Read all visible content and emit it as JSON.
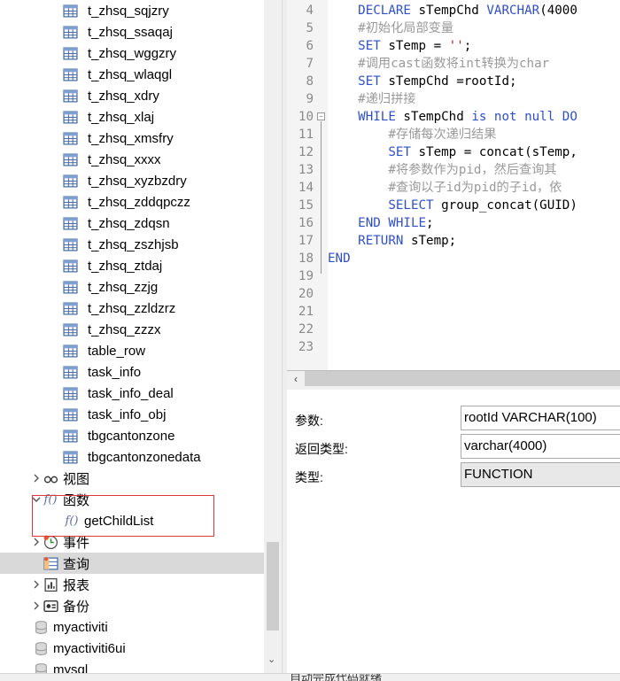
{
  "tree": {
    "tables": [
      "t_zhsq_sqjzry",
      "t_zhsq_ssaqaj",
      "t_zhsq_wggzry",
      "t_zhsq_wlaqgl",
      "t_zhsq_xdry",
      "t_zhsq_xlaj",
      "t_zhsq_xmsfry",
      "t_zhsq_xxxx",
      "t_zhsq_xyzbzdry",
      "t_zhsq_zddqpczz",
      "t_zhsq_zdqsn",
      "t_zhsq_zszhjsb",
      "t_zhsq_ztdaj",
      "t_zhsq_zzjg",
      "t_zhsq_zzldzrz",
      "t_zhsq_zzzx",
      "table_row",
      "task_info",
      "task_info_deal",
      "task_info_obj",
      "tbgcantonzone",
      "tbgcantonzonedata"
    ],
    "views_label": "视图",
    "functions_label": "函数",
    "function_item": "getChildList",
    "events_label": "事件",
    "queries_label": "查询",
    "reports_label": "报表",
    "backups_label": "备份",
    "databases": [
      "myactiviti",
      "myactiviti6ui",
      "mysql"
    ]
  },
  "editor": {
    "lines": [
      {
        "n": "4",
        "parts": [
          [
            "    ",
            ""
          ],
          [
            "DECLARE",
            "kw"
          ],
          [
            " sTempChd ",
            ""
          ],
          [
            "VARCHAR",
            "kw"
          ],
          [
            "(4000",
            ""
          ]
        ]
      },
      {
        "n": "5",
        "parts": [
          [
            "    ",
            ""
          ],
          [
            "#初始化局部变量",
            "cm"
          ]
        ]
      },
      {
        "n": "6",
        "parts": [
          [
            "    ",
            ""
          ],
          [
            "SET",
            "kw"
          ],
          [
            " sTemp = ",
            ""
          ],
          [
            "''",
            "str"
          ],
          [
            ";",
            ""
          ]
        ]
      },
      {
        "n": "7",
        "parts": [
          [
            "    ",
            ""
          ],
          [
            "#调用cast函数将int转换为char",
            "cm"
          ]
        ]
      },
      {
        "n": "8",
        "parts": [
          [
            "    ",
            ""
          ],
          [
            "SET",
            "kw"
          ],
          [
            " sTempChd =rootId;",
            ""
          ]
        ]
      },
      {
        "n": "9",
        "parts": [
          [
            "    ",
            ""
          ],
          [
            "#递归拼接",
            "cm"
          ]
        ]
      },
      {
        "n": "10",
        "parts": [
          [
            "    ",
            ""
          ],
          [
            "WHILE",
            "kw"
          ],
          [
            " sTempChd ",
            ""
          ],
          [
            "is not null DO",
            "kw"
          ]
        ]
      },
      {
        "n": "11",
        "parts": [
          [
            "        ",
            ""
          ],
          [
            "#存储每次递归结果",
            "cm"
          ]
        ]
      },
      {
        "n": "12",
        "parts": [
          [
            "        ",
            ""
          ],
          [
            "SET",
            "kw"
          ],
          [
            " sTemp = concat(sTemp,",
            ""
          ]
        ]
      },
      {
        "n": "13",
        "parts": [
          [
            "        ",
            ""
          ],
          [
            "#将参数作为pid，然后查询其",
            "cm"
          ]
        ]
      },
      {
        "n": "14",
        "parts": [
          [
            "        ",
            ""
          ],
          [
            "#查询以子id为pid的子id，依",
            "cm"
          ]
        ]
      },
      {
        "n": "15",
        "parts": [
          [
            "        ",
            ""
          ],
          [
            "SELECT",
            "kw"
          ],
          [
            " group_concat(GUID)",
            ""
          ]
        ]
      },
      {
        "n": "16",
        "parts": [
          [
            "    ",
            ""
          ],
          [
            "END WHILE",
            "kw"
          ],
          [
            ";",
            ""
          ]
        ]
      },
      {
        "n": "17",
        "parts": [
          [
            "    ",
            ""
          ],
          [
            "RETURN",
            "kw"
          ],
          [
            " sTemp;",
            ""
          ]
        ]
      },
      {
        "n": "18",
        "parts": [
          [
            "",
            ""
          ],
          [
            "END",
            "kw"
          ]
        ]
      },
      {
        "n": "19",
        "parts": []
      },
      {
        "n": "20",
        "parts": []
      },
      {
        "n": "21",
        "parts": []
      },
      {
        "n": "22",
        "parts": []
      },
      {
        "n": "23",
        "parts": []
      }
    ]
  },
  "properties": {
    "params_label": "参数:",
    "params_value": "rootId VARCHAR(100)",
    "return_label": "返回类型:",
    "return_value": "varchar(4000)",
    "type_label": "类型:",
    "type_value": "FUNCTION"
  },
  "status": {
    "text": "自动完成代码就绪"
  },
  "colors": {
    "keyword": "#2f4fc9",
    "comment": "#9a9a9a",
    "string": "#b01e1e",
    "highlight_border": "#e0383a",
    "selection": "#d9d9d9"
  },
  "icons": {
    "table": "table-grid-icon",
    "view": "glasses-icon",
    "function": "fx-icon",
    "event": "clock-icon",
    "query": "query-grid-icon",
    "report": "report-icon",
    "backup": "backup-icon",
    "database": "database-cylinder-icon"
  }
}
